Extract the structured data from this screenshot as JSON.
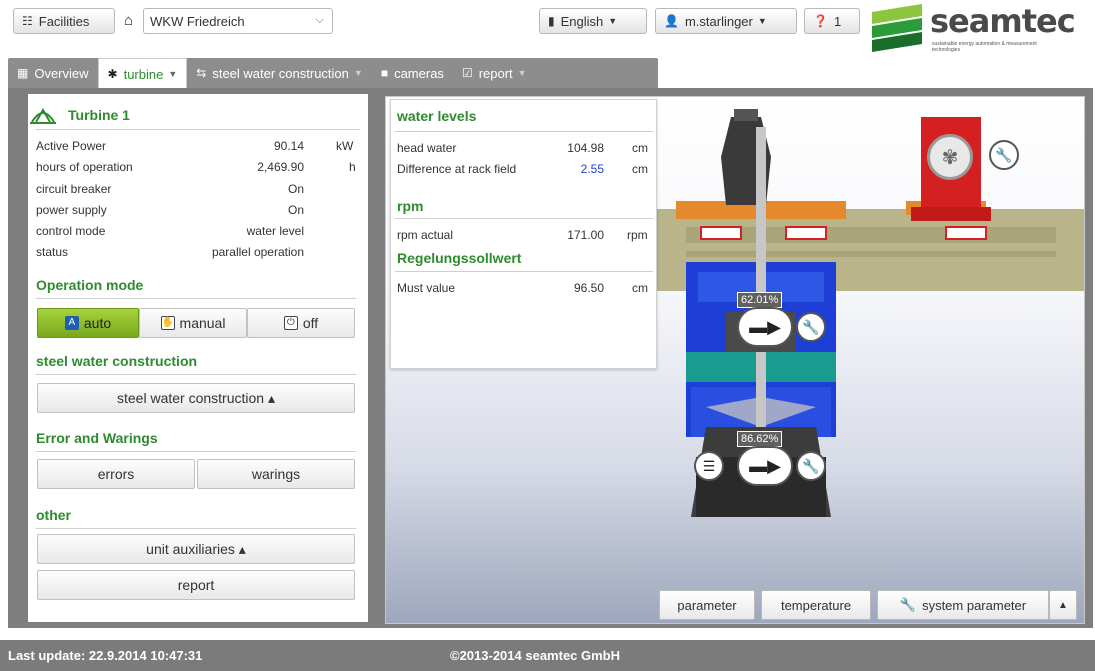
{
  "topbar": {
    "facilities_label": "Facilities",
    "facility_value": "WKW Friedreich",
    "language": "English",
    "user": "m.starlinger",
    "help_count": "1"
  },
  "logo": {
    "name": "seamtec",
    "tagline": "sustainable energy automation & measurement technologies"
  },
  "tabs": [
    {
      "label": "Overview",
      "icon": "grid-icon"
    },
    {
      "label": "turbine",
      "icon": "turbine-icon"
    },
    {
      "label": "steel water construction",
      "icon": "swap-icon"
    },
    {
      "label": "cameras",
      "icon": "camera-icon"
    },
    {
      "label": "report",
      "icon": "check-icon"
    }
  ],
  "turbine": {
    "title": "Turbine 1",
    "rows": [
      {
        "label": "Active Power",
        "value": "90.14",
        "unit": "kW"
      },
      {
        "label": "hours of operation",
        "value": "2,469.90",
        "unit": "h"
      },
      {
        "label": "circuit breaker",
        "value": "On",
        "unit": ""
      },
      {
        "label": "power supply",
        "value": "On",
        "unit": ""
      },
      {
        "label": "control mode",
        "value": "water level",
        "unit": ""
      },
      {
        "label": "status",
        "value": "parallel operation",
        "unit": ""
      }
    ]
  },
  "operation_mode": {
    "title": "Operation mode",
    "auto": "auto",
    "manual": "manual",
    "off": "off"
  },
  "swc": {
    "title": "steel water construction",
    "button": "steel water construction ▴"
  },
  "errors": {
    "title": "Error and Warings",
    "errors_btn": "errors",
    "warnings_btn": "warings"
  },
  "other": {
    "title": "other",
    "aux_btn": "unit auxiliaries ▴",
    "report_btn": "report"
  },
  "water_levels": {
    "title": "water levels",
    "head_label": "head water",
    "head_value": "104.98",
    "head_unit": "cm",
    "diff_label": "Difference at rack field",
    "diff_value": "2.55",
    "diff_unit": "cm",
    "rpm_title": "rpm",
    "rpm_label": "rpm actual",
    "rpm_value": "171.00",
    "rpm_unit": "rpm",
    "reg_title": "Regelungssollwert",
    "must_label": "Must value",
    "must_value": "96.50",
    "must_unit": "cm"
  },
  "viz": {
    "gate1_pct": "62.01%",
    "gate2_pct": "86.62%"
  },
  "bottom_buttons": {
    "parameter": "parameter",
    "temperature": "temperature",
    "system_parameter": "system parameter"
  },
  "footer": {
    "last_update": "Last update: 22.9.2014 10:47:31",
    "copyright": "©2013-2014 seamtec GmbH"
  },
  "colors": {
    "accent_green": "#2e8b2e",
    "auto_green": "#8cc02b",
    "turbine_blue": "#1e3fd6",
    "generator_red": "#d42020"
  }
}
